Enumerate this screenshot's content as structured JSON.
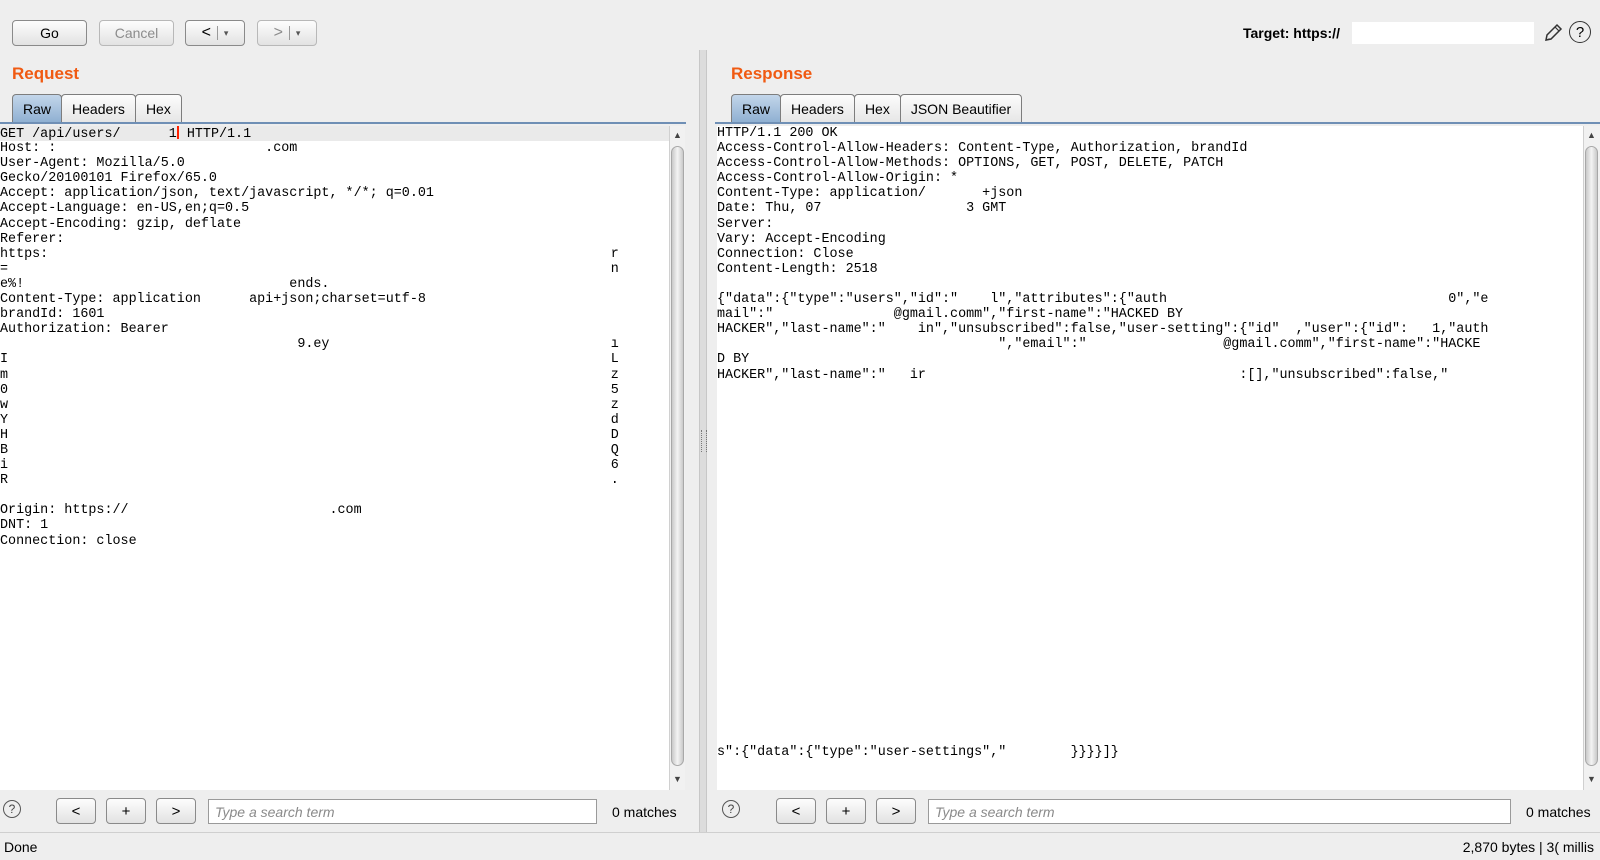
{
  "toolbar": {
    "go_label": "Go",
    "cancel_label": "Cancel",
    "back_arrow": "<",
    "forward_arrow": ">",
    "dropdown_arrow": "▾",
    "target_label": "Target: https://"
  },
  "request": {
    "title": "Request",
    "tabs": [
      {
        "label": "Raw",
        "selected": true
      },
      {
        "label": "Headers",
        "selected": false
      },
      {
        "label": "Hex",
        "selected": false
      }
    ],
    "lines": [
      "GET /api/users/      1",
      "Host: :                          .com",
      "User-Agent: Mozilla/5.0",
      "Gecko/20100101 Firefox/65.0",
      "Accept: application/json, text/javascript, */*; q=0.01",
      "Accept-Language: en-US,en;q=0.5",
      "Accept-Encoding: gzip, deflate",
      "Referer:",
      "https:                                                                      r",
      "=                                                                           n",
      "e%!                                 ends.",
      "Content-Type: application      api+json;charset=utf-8",
      "brandId: 1601",
      "Authorization: Bearer",
      "                                     9.ey                                   ı",
      "I                                                                           L",
      "m                                                                           z",
      "0                                                                           5",
      "w                                                                           z",
      "Y                                                                           d",
      "H                                                                           D",
      "B                                                                           Q",
      "i                                                                           6",
      "R                                                                           .",
      "",
      "Origin: https://                         .com",
      "DNT: 1",
      "Connection: close"
    ],
    "first_line_suffix": " HTTP/1.1",
    "search_placeholder": "Type a search term",
    "matches": "0 matches"
  },
  "response": {
    "title": "Response",
    "tabs": [
      {
        "label": "Raw",
        "selected": true
      },
      {
        "label": "Headers",
        "selected": false
      },
      {
        "label": "Hex",
        "selected": false
      },
      {
        "label": "JSON Beautifier",
        "selected": false
      }
    ],
    "lines": [
      "HTTP/1.1 200 OK",
      "Access-Control-Allow-Headers: Content-Type, Authorization, brandId",
      "Access-Control-Allow-Methods: OPTIONS, GET, POST, DELETE, PATCH",
      "Access-Control-Allow-Origin: *",
      "Content-Type: application/       +json",
      "Date: Thu, 07                  3 GMT",
      "Server:",
      "Vary: Accept-Encoding",
      "Connection: Close",
      "Content-Length: 2518",
      "",
      "{\"data\":{\"type\":\"users\",\"id\":\"    l\",\"attributes\":{\"auth                                   0\",\"e",
      "mail\":\"               @gmail.comm\",\"first-name\":\"HACKED BY",
      "HACKER\",\"last-name\":\"    in\",\"unsubscribed\":false,\"user-setting\":{\"id\"  ,\"user\":{\"id\":   1,\"auth",
      "                                   \",\"email\":\"                 @gmail.comm\",\"first-name\":\"HACKE",
      "D BY",
      "HACKER\",\"last-name\":\"   ir                                       :[],\"unsubscribed\":false,\"",
      "",
      "",
      "",
      "",
      "",
      "",
      "",
      "",
      "",
      "",
      "",
      "",
      "",
      "",
      "",
      "",
      "",
      "",
      "",
      "",
      "",
      "",
      "",
      "",
      "s\":{\"data\":{\"type\":\"user-settings\",\"        }}}}]}"
    ],
    "search_placeholder": "Type a search term",
    "matches": "0 matches"
  },
  "search_buttons": {
    "prev": "<",
    "add": "+",
    "next": ">",
    "help": "?"
  },
  "status": {
    "left": "Done",
    "right": "2,870 bytes | 3(    millis"
  },
  "icons": {
    "pencil": "pencil-icon",
    "help": "help-icon"
  },
  "colors": {
    "accent": "#f05a12",
    "tab_selected": "#a9c3df",
    "caret": "#ff2200"
  }
}
